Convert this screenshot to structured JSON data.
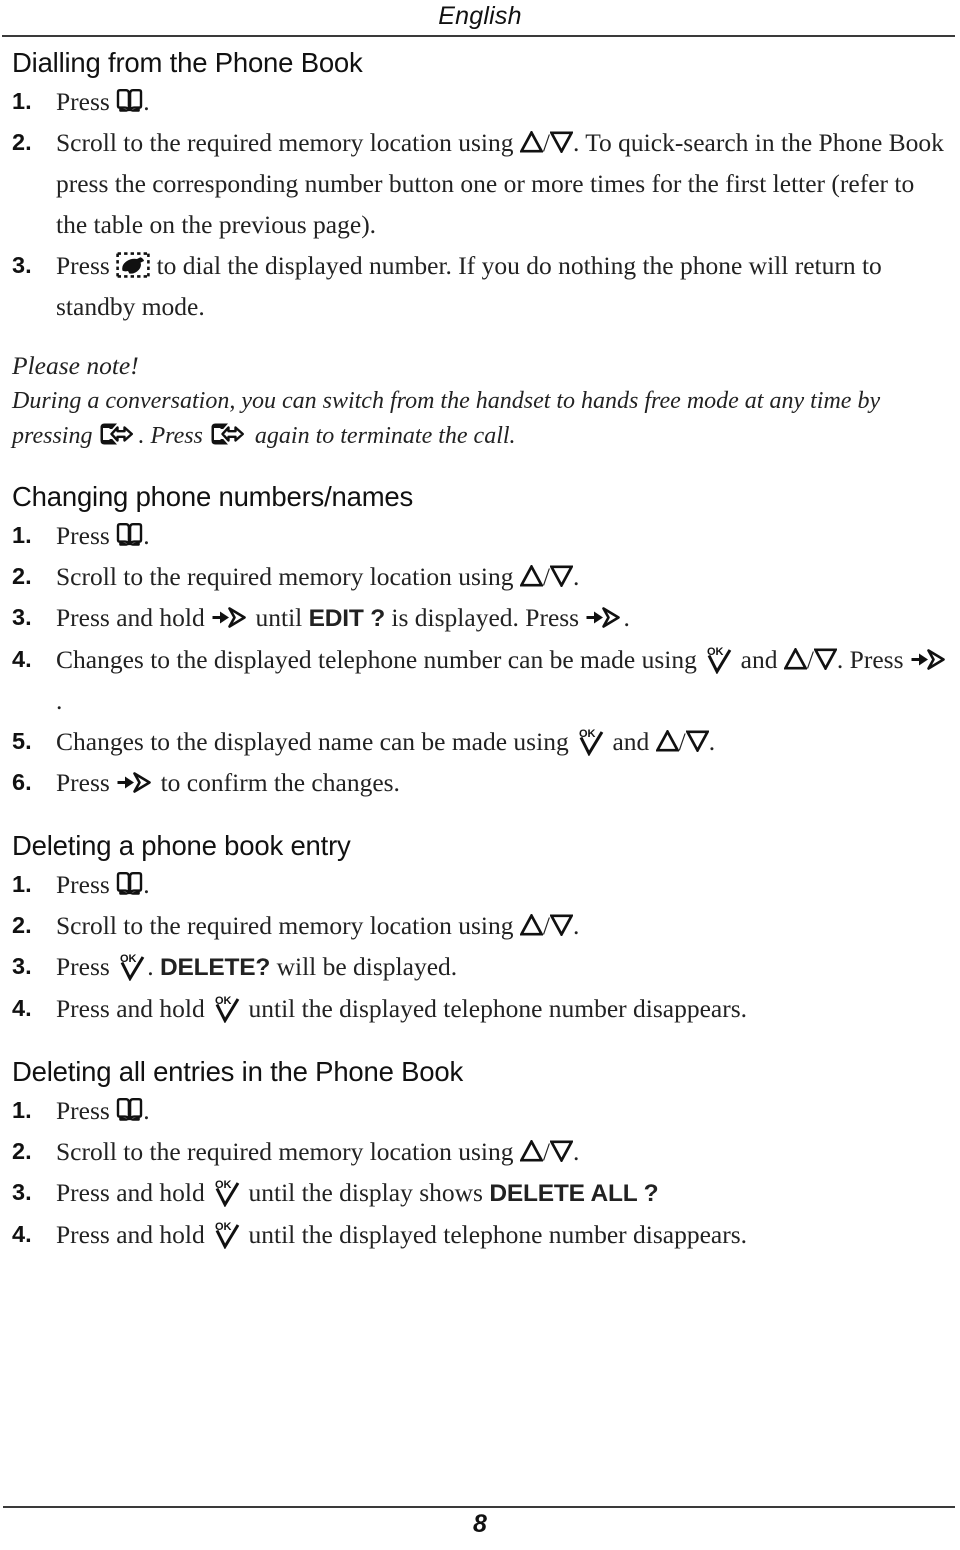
{
  "header": {
    "language_label": "English"
  },
  "footer": {
    "page_number": "8"
  },
  "icons": {
    "book": "phone-book-icon",
    "phone": "dial-handset-icon",
    "speaker": "hands-free-icon",
    "up": "scroll-up-triangle-icon",
    "down": "scroll-down-triangle-icon",
    "right_arrow": "right-arrow-icon",
    "ok": "ok-check-icon"
  },
  "sections": [
    {
      "heading": "Dialling from the Phone Book",
      "steps": [
        {
          "num": "1.",
          "parts": [
            {
              "t": "text",
              "v": "Press "
            },
            {
              "t": "icon",
              "v": "book"
            },
            {
              "t": "text",
              "v": "."
            }
          ]
        },
        {
          "num": "2.",
          "parts": [
            {
              "t": "text",
              "v": "Scroll to the required memory location using "
            },
            {
              "t": "icon",
              "v": "up"
            },
            {
              "t": "text",
              "v": "/"
            },
            {
              "t": "icon",
              "v": "down"
            },
            {
              "t": "text",
              "v": ". To quick-search in the Phone Book press the corresponding number button one or more times for the first letter (refer to the table on the previous page)."
            }
          ]
        },
        {
          "num": "3.",
          "parts": [
            {
              "t": "text",
              "v": "Press "
            },
            {
              "t": "icon",
              "v": "phone"
            },
            {
              "t": "text",
              "v": " to dial the displayed number. If you do nothing the phone will return to standby mode."
            }
          ]
        }
      ]
    }
  ],
  "note": {
    "title": "Please note!",
    "parts": [
      {
        "t": "text",
        "v": "During a conversation, you can switch from the handset to hands free mode at any time by pressing "
      },
      {
        "t": "icon",
        "v": "speaker"
      },
      {
        "t": "text",
        "v": ". Press "
      },
      {
        "t": "icon",
        "v": "speaker"
      },
      {
        "t": "text",
        "v": " again to terminate the call."
      }
    ]
  },
  "sections2": [
    {
      "heading": "Changing phone numbers/names",
      "steps": [
        {
          "num": "1.",
          "parts": [
            {
              "t": "text",
              "v": "Press "
            },
            {
              "t": "icon",
              "v": "book"
            },
            {
              "t": "text",
              "v": "."
            }
          ]
        },
        {
          "num": "2.",
          "parts": [
            {
              "t": "text",
              "v": "Scroll to the required memory location using "
            },
            {
              "t": "icon",
              "v": "up"
            },
            {
              "t": "text",
              "v": "/"
            },
            {
              "t": "icon",
              "v": "down"
            },
            {
              "t": "text",
              "v": "."
            }
          ]
        },
        {
          "num": "3.",
          "parts": [
            {
              "t": "text",
              "v": "Press and hold "
            },
            {
              "t": "icon",
              "v": "right_arrow"
            },
            {
              "t": "text",
              "v": " until "
            },
            {
              "t": "bold",
              "v": "EDIT ?"
            },
            {
              "t": "text",
              "v": " is displayed. Press "
            },
            {
              "t": "icon",
              "v": "right_arrow"
            },
            {
              "t": "text",
              "v": "."
            }
          ]
        },
        {
          "num": "4.",
          "parts": [
            {
              "t": "text",
              "v": "Changes to the displayed telephone number can be made using "
            },
            {
              "t": "icon",
              "v": "ok"
            },
            {
              "t": "text",
              "v": " and "
            },
            {
              "t": "icon",
              "v": "up"
            },
            {
              "t": "text",
              "v": "/"
            },
            {
              "t": "icon",
              "v": "down"
            },
            {
              "t": "text",
              "v": ". Press "
            },
            {
              "t": "icon",
              "v": "right_arrow"
            },
            {
              "t": "text",
              "v": "."
            }
          ]
        },
        {
          "num": "5.",
          "parts": [
            {
              "t": "text",
              "v": "Changes to the displayed name can be made using "
            },
            {
              "t": "icon",
              "v": "ok"
            },
            {
              "t": "text",
              "v": " and "
            },
            {
              "t": "icon",
              "v": "up"
            },
            {
              "t": "text",
              "v": "/"
            },
            {
              "t": "icon",
              "v": "down"
            },
            {
              "t": "text",
              "v": "."
            }
          ]
        },
        {
          "num": "6.",
          "parts": [
            {
              "t": "text",
              "v": "Press "
            },
            {
              "t": "icon",
              "v": "right_arrow"
            },
            {
              "t": "text",
              "v": " to confirm the changes."
            }
          ]
        }
      ]
    },
    {
      "heading": "Deleting a phone book entry",
      "steps": [
        {
          "num": "1.",
          "parts": [
            {
              "t": "text",
              "v": "Press "
            },
            {
              "t": "icon",
              "v": "book"
            },
            {
              "t": "text",
              "v": "."
            }
          ]
        },
        {
          "num": "2.",
          "parts": [
            {
              "t": "text",
              "v": "Scroll to the required memory location using "
            },
            {
              "t": "icon",
              "v": "up"
            },
            {
              "t": "text",
              "v": "/"
            },
            {
              "t": "icon",
              "v": "down"
            },
            {
              "t": "text",
              "v": "."
            }
          ]
        },
        {
          "num": "3.",
          "parts": [
            {
              "t": "text",
              "v": "Press "
            },
            {
              "t": "icon",
              "v": "ok"
            },
            {
              "t": "text",
              "v": ". "
            },
            {
              "t": "bold",
              "v": "DELETE?"
            },
            {
              "t": "text",
              "v": " will be displayed."
            }
          ]
        },
        {
          "num": "4.",
          "parts": [
            {
              "t": "text",
              "v": "Press and hold "
            },
            {
              "t": "icon",
              "v": "ok"
            },
            {
              "t": "text",
              "v": " until the displayed telephone number disappears."
            }
          ]
        }
      ]
    },
    {
      "heading": "Deleting all entries in the Phone Book",
      "steps": [
        {
          "num": "1.",
          "parts": [
            {
              "t": "text",
              "v": "Press "
            },
            {
              "t": "icon",
              "v": "book"
            },
            {
              "t": "text",
              "v": "."
            }
          ]
        },
        {
          "num": "2.",
          "parts": [
            {
              "t": "text",
              "v": "Scroll to the required memory location using "
            },
            {
              "t": "icon",
              "v": "up"
            },
            {
              "t": "text",
              "v": "/"
            },
            {
              "t": "icon",
              "v": "down"
            },
            {
              "t": "text",
              "v": "."
            }
          ]
        },
        {
          "num": "3.",
          "parts": [
            {
              "t": "text",
              "v": "Press and hold "
            },
            {
              "t": "icon",
              "v": "ok"
            },
            {
              "t": "text",
              "v": " until the display shows "
            },
            {
              "t": "bold",
              "v": "DELETE ALL ?"
            }
          ]
        },
        {
          "num": "4.",
          "parts": [
            {
              "t": "text",
              "v": "Press and hold "
            },
            {
              "t": "icon",
              "v": "ok"
            },
            {
              "t": "text",
              "v": " until the displayed telephone number disappears."
            }
          ]
        }
      ]
    }
  ]
}
